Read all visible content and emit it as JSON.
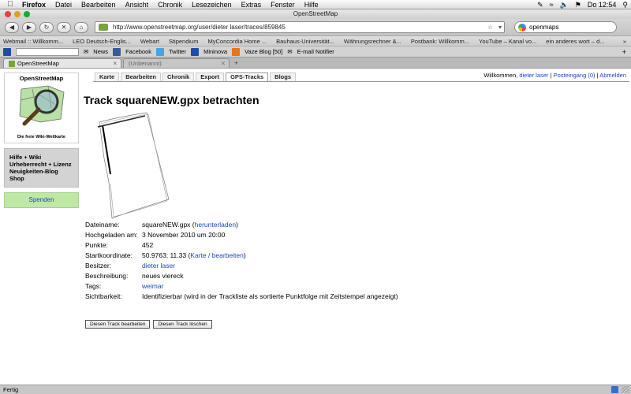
{
  "os_menubar": {
    "app_name": "Firefox",
    "menus": [
      "Datei",
      "Bearbeiten",
      "Ansicht",
      "Chronik",
      "Lesezeichen",
      "Extras",
      "Fenster",
      "Hilfe"
    ],
    "clock": "Do 12:54"
  },
  "window": {
    "title": "OpenStreetMap"
  },
  "toolbar": {
    "url": "http://www.openstreetmap.org/user/dieter laser/traces/859845",
    "search_value": "openmaps"
  },
  "bookmarks": [
    "Webmail :: Willkomm...",
    "LEO Deutsch-Englis...",
    "Webart",
    "Stipendium",
    "MyConcordia Home ...",
    "Bauhaus-Universität...",
    "Währungsrechner &...",
    "Postbank: Willkomm...",
    "YouTube – Kanal vo...",
    "ein anderes wort – d..."
  ],
  "addonbar": {
    "items": [
      "News",
      "Facebook",
      "Twitter",
      "Mininova",
      "Vaze Blog [50]",
      "E-mail Notifier"
    ]
  },
  "tabs": [
    {
      "label": "OpenStreetMap"
    },
    {
      "label": "(Unbenannt)"
    }
  ],
  "osm": {
    "logo_title": "OpenStreetMap",
    "logo_tagline": "Die freie Wiki-Weltkarte",
    "left_links": [
      "Hilfe + Wiki",
      "Urheberrecht + Lizenz",
      "Neuigkeiten-Blog",
      "Shop"
    ],
    "donate": "Spenden",
    "nav_tabs": [
      "Karte",
      "Bearbeiten",
      "Chronik",
      "Export",
      "GPS-Tracks",
      "Blogs"
    ],
    "active_tab": "GPS-Tracks",
    "greeting_prefix": "Willkommen,",
    "user": "dieter laser",
    "inbox": "Posteingang (0)",
    "logout": "Abmelden",
    "heading": "Track squareNEW.gpx betrachten",
    "details": [
      {
        "key": "Dateiname:",
        "value": "squareNEW.gpx",
        "link": "herunterladen"
      },
      {
        "key": "Hochgeladen am:",
        "value": "3 November 2010 um 20:00"
      },
      {
        "key": "Punkte:",
        "value": "452"
      },
      {
        "key": "Startkoordinate:",
        "value": "50.9763; 11.33",
        "link": "Karte / bearbeiten"
      },
      {
        "key": "Besitzer:",
        "link": "dieter laser"
      },
      {
        "key": "Beschreibung:",
        "value": "neues viereck"
      },
      {
        "key": "Tags:",
        "link": "weimar"
      },
      {
        "key": "Sichtbarkeit:",
        "value": "Identifizierbar (wird in der Trackliste als sortierte Punktfolge mit Zeitstempel angezeigt)"
      }
    ],
    "edit_button": "Diesen Track bearbeiten",
    "delete_button": "Diesen Track löschen"
  },
  "statusbar": {
    "text": "Fertig"
  }
}
